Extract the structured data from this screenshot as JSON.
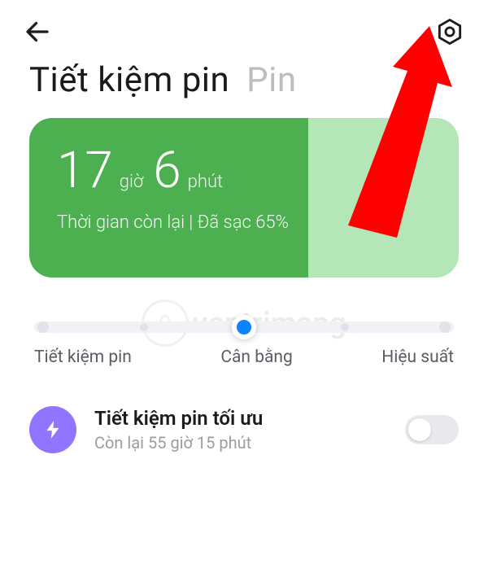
{
  "title": {
    "main": "Tiết kiệm pin",
    "sub": "Pin"
  },
  "battery": {
    "hours_value": "17",
    "hours_unit": "giờ",
    "minutes_value": "6",
    "minutes_unit": "phút",
    "status": "Thời gian còn lại | Đã sạc 65%"
  },
  "slider": {
    "labels": {
      "left": "Tiết kiệm pin",
      "center": "Cân bằng",
      "right": "Hiệu suất"
    }
  },
  "optimal": {
    "title": "Tiết kiệm pin tối ưu",
    "subtitle": "Còn lại 55 giờ 15 phút"
  },
  "watermark": "uantrimang"
}
